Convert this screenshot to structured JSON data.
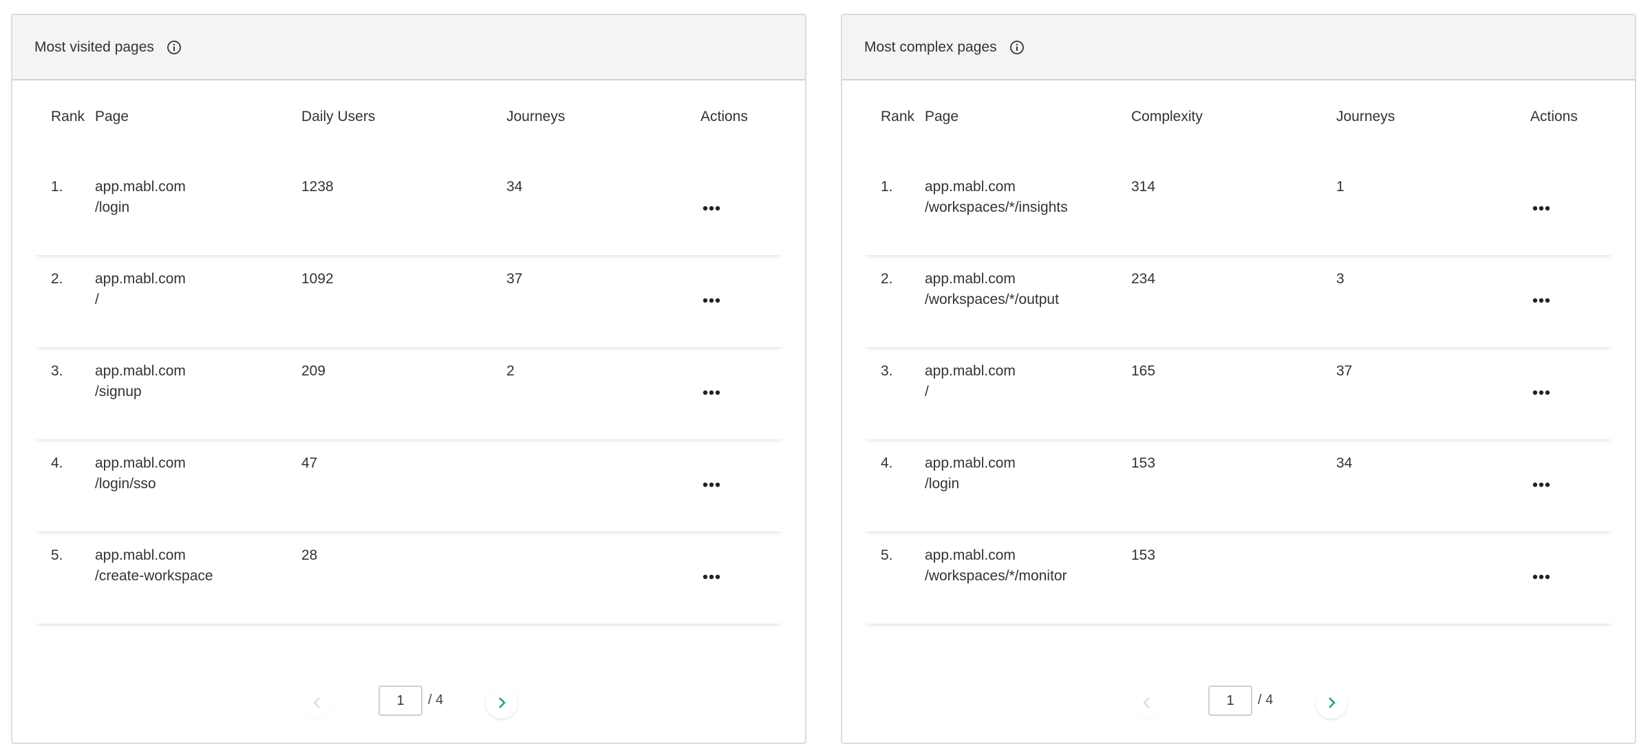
{
  "left_panel": {
    "title": "Most visited pages",
    "columns": {
      "rank": "Rank",
      "page": "Page",
      "metric": "Daily Users",
      "journeys": "Journeys",
      "actions": "Actions"
    },
    "rows": [
      {
        "rank": "1.",
        "domain": "app.mabl.com",
        "path": "/login",
        "metric": "1238",
        "journeys": "34"
      },
      {
        "rank": "2.",
        "domain": "app.mabl.com",
        "path": "/",
        "metric": "1092",
        "journeys": "37"
      },
      {
        "rank": "3.",
        "domain": "app.mabl.com",
        "path": "/signup",
        "metric": "209",
        "journeys": "2"
      },
      {
        "rank": "4.",
        "domain": "app.mabl.com",
        "path": "/login/sso",
        "metric": "47",
        "journeys": ""
      },
      {
        "rank": "5.",
        "domain": "app.mabl.com",
        "path": "/create-workspace",
        "metric": "28",
        "journeys": ""
      }
    ],
    "pagination": {
      "current": "1",
      "total_label": "/ 4"
    }
  },
  "right_panel": {
    "title": "Most complex pages",
    "columns": {
      "rank": "Rank",
      "page": "Page",
      "metric": "Complexity",
      "journeys": "Journeys",
      "actions": "Actions"
    },
    "rows": [
      {
        "rank": "1.",
        "domain": "app.mabl.com",
        "path": "/workspaces/*/insights",
        "metric": "314",
        "journeys": "1"
      },
      {
        "rank": "2.",
        "domain": "app.mabl.com",
        "path": "/workspaces/*/output",
        "metric": "234",
        "journeys": "3"
      },
      {
        "rank": "3.",
        "domain": "app.mabl.com",
        "path": "/",
        "metric": "165",
        "journeys": "37"
      },
      {
        "rank": "4.",
        "domain": "app.mabl.com",
        "path": "/login",
        "metric": "153",
        "journeys": "34"
      },
      {
        "rank": "5.",
        "domain": "app.mabl.com",
        "path": "/workspaces/*/monitor",
        "metric": "153",
        "journeys": ""
      }
    ],
    "pagination": {
      "current": "1",
      "total_label": "/ 4"
    }
  },
  "colors": {
    "accent": "#1fa08a",
    "accent_disabled": "#c7e5df",
    "header_bg": "#f4f4f4",
    "border": "#dcdcdc"
  },
  "icons": {
    "info": "info-circle-icon",
    "actions": "more-horizontal-icon",
    "prev": "chevron-left-icon",
    "next": "chevron-right-icon"
  }
}
